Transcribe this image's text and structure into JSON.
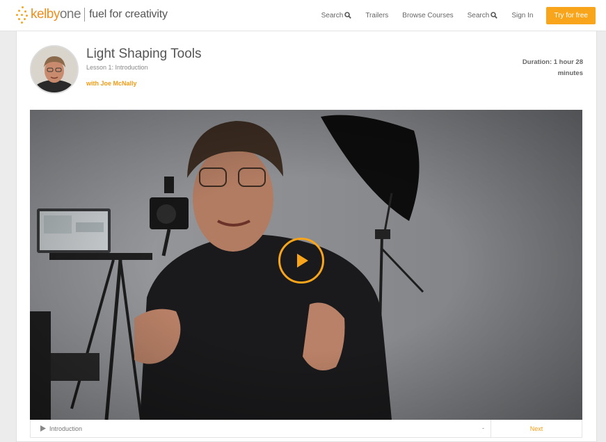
{
  "header": {
    "logo": {
      "brand": "kelby",
      "brand_suffix": "one",
      "tagline": "fuel for creativity"
    },
    "nav": [
      {
        "label": "Search",
        "icon": "search-icon"
      },
      {
        "label": "Trailers"
      },
      {
        "label": "Browse Courses"
      },
      {
        "label": "Search",
        "icon": "search-icon"
      },
      {
        "label": "Sign In"
      }
    ],
    "cta_label": "Try for free"
  },
  "course": {
    "title": "Light Shaping Tools",
    "lesson": "Lesson 1: Introduction",
    "author": "with Joe McNally",
    "duration": "Duration: 1 hour 28 minutes"
  },
  "player": {
    "playlist_current": "Introduction",
    "playlist_toggle": "-",
    "next_label": "Next"
  },
  "colors": {
    "accent": "#f8a51b",
    "text": "#555555",
    "background": "#ececec"
  }
}
